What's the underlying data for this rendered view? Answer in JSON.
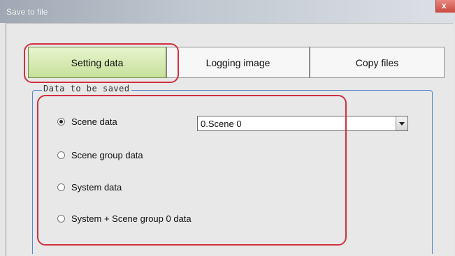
{
  "window": {
    "title": "Save to file",
    "close_glyph": "x"
  },
  "tabs": [
    {
      "label": "Setting data",
      "selected": true
    },
    {
      "label": "Logging image",
      "selected": false
    },
    {
      "label": "Copy files",
      "selected": false
    }
  ],
  "group": {
    "legend": "Data to be saved"
  },
  "options": [
    {
      "label": "Scene data",
      "checked": true
    },
    {
      "label": "Scene group data",
      "checked": false
    },
    {
      "label": "System data",
      "checked": false
    },
    {
      "label": "System + Scene group 0 data",
      "checked": false
    }
  ],
  "scene_select": {
    "value": "0.Scene 0",
    "icon": "chevron-down-icon"
  },
  "colors": {
    "selected_tab": "#c6e19a",
    "highlight": "#d2303f",
    "group_border": "#5a86c9"
  }
}
